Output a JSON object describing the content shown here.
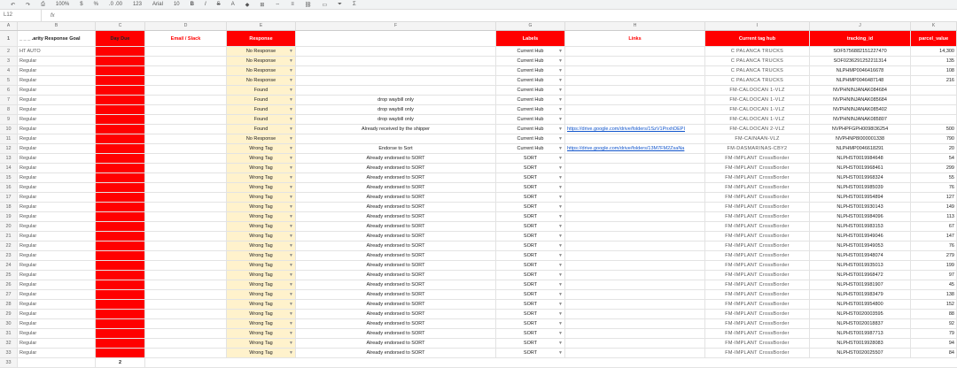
{
  "formula_bar": {
    "cell_ref": "L12",
    "fx": "fx"
  },
  "toolbar": {
    "zoom": "100%",
    "currency": "$",
    "percent": "%",
    "decimals": ".0 .00",
    "format": "123",
    "font": "Arial",
    "size": "10"
  },
  "column_letters": [
    "",
    "A",
    "B",
    "C",
    "D",
    "E",
    "F",
    "G",
    "H",
    "I",
    "J",
    "K"
  ],
  "headers": {
    "row_num": "1",
    "b": "_ _ _ .arity Response Goal",
    "c": "Day Due",
    "e": "Email / Slack",
    "response": "Response",
    "f": "",
    "labels": "Labels",
    "links": "Links",
    "hub": "Current tag hub",
    "tracking": "tracking_id",
    "parcel": "parcel_value"
  },
  "rows": [
    {
      "n": "2",
      "b": "HT AUTO",
      "resp": "No Response",
      "f": "",
      "label": "Current Hub",
      "link": "",
      "hub": "C PALANCA TRUCKS",
      "trk": "SOF5756882151227470",
      "val": "14,300"
    },
    {
      "n": "3",
      "b": "Regular",
      "resp": "No Response",
      "f": "",
      "label": "Current Hub",
      "link": "",
      "hub": "C PALANCA TRUCKS",
      "trk": "SOF0236291252211314",
      "val": "135"
    },
    {
      "n": "4",
      "b": "Regular",
      "resp": "No Response",
      "f": "",
      "label": "Current Hub",
      "link": "",
      "hub": "C PALANCA TRUCKS",
      "trk": "NLPHMP0046416678",
      "val": "108"
    },
    {
      "n": "5",
      "b": "Regular",
      "resp": "No Response",
      "f": "",
      "label": "Current Hub",
      "link": "",
      "hub": "C PALANCA TRUCKS",
      "trk": "NLPHMP0046487148",
      "val": "216"
    },
    {
      "n": "6",
      "b": "Regular",
      "resp": "Found",
      "f": "",
      "label": "Current Hub",
      "link": "",
      "hub": "FM-CALOOCAN 1-VLZ",
      "trk": "NVPHNINJANAK084684",
      "val": ""
    },
    {
      "n": "7",
      "b": "Regular",
      "resp": "Found",
      "f": "drop waybill only",
      "label": "Current Hub",
      "link": "",
      "hub": "FM-CALOOCAN 1-VLZ",
      "trk": "NVPHNINJANAK085684",
      "val": ""
    },
    {
      "n": "8",
      "b": "Regular",
      "resp": "Found",
      "f": "drop waybill only",
      "label": "Current Hub",
      "link": "",
      "hub": "FM-CALOOCAN 1-VLZ",
      "trk": "NVPHNINJANAK085402",
      "val": ""
    },
    {
      "n": "9",
      "b": "Regular",
      "resp": "Found",
      "f": "drop waybill only",
      "label": "Current Hub",
      "link": "",
      "hub": "FM-CALOOCAN 1-VLZ",
      "trk": "NVPHNINJANAK085807",
      "val": ""
    },
    {
      "n": "10",
      "b": "Regular",
      "resp": "Found",
      "f": "Already received by the shipper",
      "label": "Current Hub",
      "link": "https://drive.google.com/drive/folders/1SzV1PnxhDEPI",
      "hub": "FM-CALOOCAN 2-VLZ",
      "trk": "NVPHPFGPH0098I36254",
      "val": "500"
    },
    {
      "n": "11",
      "b": "Regular",
      "resp": "No Response",
      "f": "",
      "label": "Current Hub",
      "link": "",
      "hub": "FM-CAINAAN-VLZ",
      "trk": "NVPHNP8I000001338",
      "val": "790"
    },
    {
      "n": "12",
      "b": "Regular",
      "resp": "Wrong Tag",
      "f": "Endorse to Sort",
      "label": "Current Hub",
      "link": "https://drive.google.com/drive/folders/13M7FM2ZsaNa",
      "hub": "FM-DASMARINAS-CBY2",
      "trk": "NLPHMP0046618291",
      "val": "20"
    },
    {
      "n": "13",
      "b": "Regular",
      "resp": "Wrong Tag",
      "f": "Already endorsed to SORT",
      "label": "SORT",
      "link": "",
      "hub": "FM-IMPLANT CrossBorder",
      "trk": "NLPHST0019984648",
      "val": "54"
    },
    {
      "n": "14",
      "b": "Regular",
      "resp": "Wrong Tag",
      "f": "Already endorsed to SORT",
      "label": "SORT",
      "link": "",
      "hub": "FM-IMPLANT CrossBorder",
      "trk": "NLPHST0019968461",
      "val": "299"
    },
    {
      "n": "15",
      "b": "Regular",
      "resp": "Wrong Tag",
      "f": "Already endorsed to SORT",
      "label": "SORT",
      "link": "",
      "hub": "FM-IMPLANT CrossBorder",
      "trk": "NLPHST0019968324",
      "val": "55"
    },
    {
      "n": "16",
      "b": "Regular",
      "resp": "Wrong Tag",
      "f": "Already endorsed to SORT",
      "label": "SORT",
      "link": "",
      "hub": "FM-IMPLANT CrossBorder",
      "trk": "NLPHST0019985039",
      "val": "76"
    },
    {
      "n": "17",
      "b": "Regular",
      "resp": "Wrong Tag",
      "f": "Already endorsed to SORT",
      "label": "SORT",
      "link": "",
      "hub": "FM-IMPLANT CrossBorder",
      "trk": "NLPHST0019954894",
      "val": "127"
    },
    {
      "n": "18",
      "b": "Regular",
      "resp": "Wrong Tag",
      "f": "Already endorsed to SORT",
      "label": "SORT",
      "link": "",
      "hub": "FM-IMPLANT CrossBorder",
      "trk": "NLPHST0019930143",
      "val": "149"
    },
    {
      "n": "19",
      "b": "Regular",
      "resp": "Wrong Tag",
      "f": "Already endorsed to SORT",
      "label": "SORT",
      "link": "",
      "hub": "FM-IMPLANT CrossBorder",
      "trk": "NLPHST0019984096",
      "val": "113"
    },
    {
      "n": "20",
      "b": "Regular",
      "resp": "Wrong Tag",
      "f": "Already endorsed to SORT",
      "label": "SORT",
      "link": "",
      "hub": "FM-IMPLANT CrossBorder",
      "trk": "NLPHST0019983153",
      "val": "67"
    },
    {
      "n": "21",
      "b": "Regular",
      "resp": "Wrong Tag",
      "f": "Already endorsed to SORT",
      "label": "SORT",
      "link": "",
      "hub": "FM-IMPLANT CrossBorder",
      "trk": "NLPHST0019949046",
      "val": "147"
    },
    {
      "n": "22",
      "b": "Regular",
      "resp": "Wrong Tag",
      "f": "Already endorsed to SORT",
      "label": "SORT",
      "link": "",
      "hub": "FM-IMPLANT CrossBorder",
      "trk": "NLPHST0019949053",
      "val": "76"
    },
    {
      "n": "23",
      "b": "Regular",
      "resp": "Wrong Tag",
      "f": "Already endorsed to SORT",
      "label": "SORT",
      "link": "",
      "hub": "FM-IMPLANT CrossBorder",
      "trk": "NLPHST0019948074",
      "val": "279"
    },
    {
      "n": "24",
      "b": "Regular",
      "resp": "Wrong Tag",
      "f": "Already endorsed to SORT",
      "label": "SORT",
      "link": "",
      "hub": "FM-IMPLANT CrossBorder",
      "trk": "NLPHST0019935013",
      "val": "199"
    },
    {
      "n": "25",
      "b": "Regular",
      "resp": "Wrong Tag",
      "f": "Already endorsed to SORT",
      "label": "SORT",
      "link": "",
      "hub": "FM-IMPLANT CrossBorder",
      "trk": "NLPHST0019968472",
      "val": "97"
    },
    {
      "n": "26",
      "b": "Regular",
      "resp": "Wrong Tag",
      "f": "Already endorsed to SORT",
      "label": "SORT",
      "link": "",
      "hub": "FM-IMPLANT CrossBorder",
      "trk": "NLPHST0019981907",
      "val": "45"
    },
    {
      "n": "27",
      "b": "Regular",
      "resp": "Wrong Tag",
      "f": "Already endorsed to SORT",
      "label": "SORT",
      "link": "",
      "hub": "FM-IMPLANT CrossBorder",
      "trk": "NLPHST0019983479",
      "val": "138"
    },
    {
      "n": "28",
      "b": "Regular",
      "resp": "Wrong Tag",
      "f": "Already endorsed to SORT",
      "label": "SORT",
      "link": "",
      "hub": "FM-IMPLANT CrossBorder",
      "trk": "NLPHST0019954800",
      "val": "152"
    },
    {
      "n": "29",
      "b": "Regular",
      "resp": "Wrong Tag",
      "f": "Already endorsed to SORT",
      "label": "SORT",
      "link": "",
      "hub": "FM-IMPLANT CrossBorder",
      "trk": "NLPHST0020003595",
      "val": "88"
    },
    {
      "n": "30",
      "b": "Regular",
      "resp": "Wrong Tag",
      "f": "Already endorsed to SORT",
      "label": "SORT",
      "link": "",
      "hub": "FM-IMPLANT CrossBorder",
      "trk": "NLPHST0020018837",
      "val": "92"
    },
    {
      "n": "31",
      "b": "Regular",
      "resp": "Wrong Tag",
      "f": "Already endorsed to SORT",
      "label": "SORT",
      "link": "",
      "hub": "FM-IMPLANT CrossBorder",
      "trk": "NLPHST0019987713",
      "val": "79"
    },
    {
      "n": "32",
      "b": "Regular",
      "resp": "Wrong Tag",
      "f": "Already endorsed to SORT",
      "label": "SORT",
      "link": "",
      "hub": "FM-IMPLANT CrossBorder",
      "trk": "NLPHST0019928083",
      "val": "94"
    },
    {
      "n": "33",
      "b": "Regular",
      "resp": "Wrong Tag",
      "f": "Already endorsed to SORT",
      "label": "SORT",
      "link": "",
      "hub": "FM-IMPLANT CrossBorder",
      "trk": "NLPHST0020025507",
      "val": "84"
    }
  ],
  "last_row": {
    "n": "33",
    "c": "2"
  }
}
